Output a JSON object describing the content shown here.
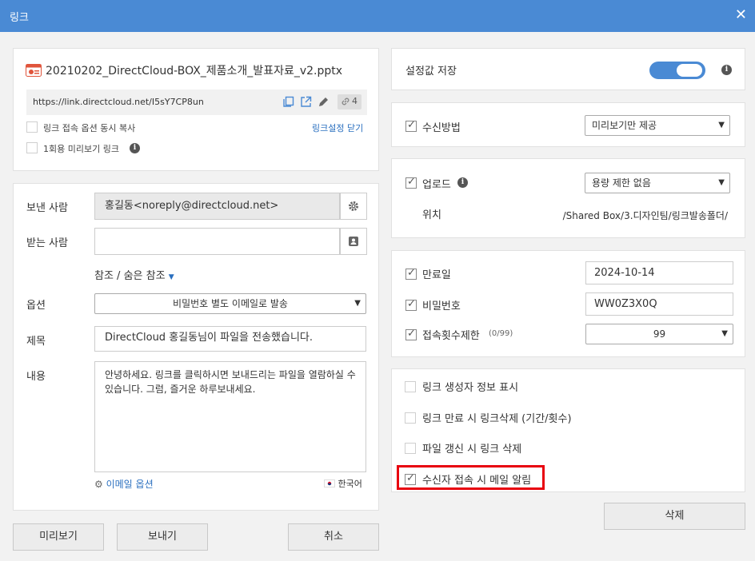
{
  "window": {
    "title": "링크",
    "close_glyph": "✕"
  },
  "file": {
    "name": "20210202_DirectCloud-BOX_제품소개_발표자료_v2.pptx",
    "url": "https://link.directcloud.net/I5sY7CP8un",
    "link_count": "4"
  },
  "link_options": {
    "copy_with_options": "링크 접속 옵션 동시 복사",
    "close_settings": "링크설정 닫기",
    "one_time_preview": "1회용 미리보기 링크"
  },
  "mail": {
    "sender_label": "보낸 사람",
    "sender_value": "홍길동<noreply@directcloud.net>",
    "recipient_label": "받는 사람",
    "recipient_value": "",
    "cc_toggle": "참조 / 숨은 참조",
    "option_label": "옵션",
    "option_value": "비밀번호 별도 이메일로 발송",
    "subject_label": "제목",
    "subject_value": "DirectCloud 홍길동님이 파일을 전송했습니다.",
    "body_label": "내용",
    "body_value": "안녕하세요. 링크를 클릭하시면 보내드리는 파일을 열람하실 수 있습니다. 그럼, 즐거운 하루보내세요.",
    "email_options": "이메일 옵션",
    "language": "한국어"
  },
  "footer": {
    "preview": "미리보기",
    "send": "보내기",
    "cancel": "취소",
    "delete": "삭제"
  },
  "settings": {
    "save_label": "설정값 저장",
    "save_on": true,
    "receive_label": "수신방법",
    "receive_value": "미리보기만 제공",
    "upload_label": "업로드",
    "upload_value": "용량 제한 없음",
    "location_label": "위치",
    "location_value": "/Shared Box/3.디자인팀/링크발송폴더/",
    "expiry_label": "만료일",
    "expiry_value": "2024-10-14",
    "password_label": "비밀번호",
    "password_value": "WW0Z3X0Q",
    "access_limit_label": "접속횟수제한",
    "access_limit_hint": "(0/99)",
    "access_limit_value": "99",
    "show_creator": "링크 생성자 정보 표시",
    "delete_on_expiry": "링크 만료 시 링크삭제 (기간/횟수)",
    "delete_on_update": "파일 갱신 시 링크 삭제",
    "notify_on_access": "수신자 접속 시 메일 알림"
  },
  "colors": {
    "titlebar": "#4a8ad4",
    "toggle": "#4a8ad4",
    "link": "#2a6fbf",
    "highlight": "#e8000e"
  },
  "icons": [
    "pptx-file-icon",
    "copy-icon",
    "external-link-icon",
    "pencil-icon",
    "link-icon",
    "gear-icon",
    "address-book-icon",
    "info-icon",
    "caret-down-icon",
    "korea-flag-icon"
  ]
}
